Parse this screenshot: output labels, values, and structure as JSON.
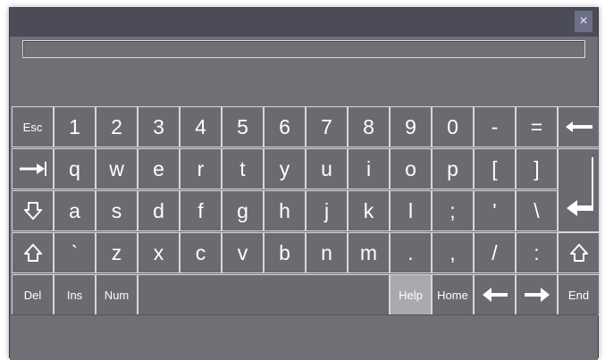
{
  "window": {
    "close_icon": "×",
    "input_value": ""
  },
  "keyboard": {
    "rows": [
      [
        {
          "label": "Esc",
          "name": "key-esc",
          "small": true
        },
        {
          "label": "1",
          "name": "key-1"
        },
        {
          "label": "2",
          "name": "key-2"
        },
        {
          "label": "3",
          "name": "key-3"
        },
        {
          "label": "4",
          "name": "key-4"
        },
        {
          "label": "5",
          "name": "key-5"
        },
        {
          "label": "6",
          "name": "key-6"
        },
        {
          "label": "7",
          "name": "key-7"
        },
        {
          "label": "8",
          "name": "key-8"
        },
        {
          "label": "9",
          "name": "key-9"
        },
        {
          "label": "0",
          "name": "key-0"
        },
        {
          "label": "-",
          "name": "key-minus"
        },
        {
          "label": "=",
          "name": "key-equals"
        },
        {
          "icon": "backspace-icon",
          "name": "key-backspace"
        }
      ],
      [
        {
          "icon": "tab-icon",
          "name": "key-tab"
        },
        {
          "label": "q",
          "name": "key-q"
        },
        {
          "label": "w",
          "name": "key-w"
        },
        {
          "label": "e",
          "name": "key-e"
        },
        {
          "label": "r",
          "name": "key-r"
        },
        {
          "label": "t",
          "name": "key-t"
        },
        {
          "label": "y",
          "name": "key-y"
        },
        {
          "label": "u",
          "name": "key-u"
        },
        {
          "label": "i",
          "name": "key-i"
        },
        {
          "label": "o",
          "name": "key-o"
        },
        {
          "label": "p",
          "name": "key-p"
        },
        {
          "label": "[",
          "name": "key-left-bracket"
        },
        {
          "label": "]",
          "name": "key-right-bracket"
        }
      ],
      [
        {
          "icon": "caps-lock-icon",
          "name": "key-caps-lock"
        },
        {
          "label": "a",
          "name": "key-a"
        },
        {
          "label": "s",
          "name": "key-s"
        },
        {
          "label": "d",
          "name": "key-d"
        },
        {
          "label": "f",
          "name": "key-f"
        },
        {
          "label": "g",
          "name": "key-g"
        },
        {
          "label": "h",
          "name": "key-h"
        },
        {
          "label": "j",
          "name": "key-j"
        },
        {
          "label": "k",
          "name": "key-k"
        },
        {
          "label": "l",
          "name": "key-l"
        },
        {
          "label": ";",
          "name": "key-semicolon"
        },
        {
          "label": "'",
          "name": "key-apostrophe"
        },
        {
          "label": "\\",
          "name": "key-backslash"
        },
        {
          "icon": "enter-icon",
          "name": "key-enter"
        }
      ],
      [
        {
          "icon": "shift-icon",
          "name": "key-shift-left"
        },
        {
          "label": "`",
          "name": "key-backtick"
        },
        {
          "label": "z",
          "name": "key-z"
        },
        {
          "label": "x",
          "name": "key-x"
        },
        {
          "label": "c",
          "name": "key-c"
        },
        {
          "label": "v",
          "name": "key-v"
        },
        {
          "label": "b",
          "name": "key-b"
        },
        {
          "label": "n",
          "name": "key-n"
        },
        {
          "label": "m",
          "name": "key-m"
        },
        {
          "label": ".",
          "name": "key-period"
        },
        {
          "label": ",",
          "name": "key-comma"
        },
        {
          "label": "/",
          "name": "key-slash"
        },
        {
          "label": ":",
          "name": "key-colon"
        },
        {
          "icon": "shift-icon",
          "name": "key-shift-right"
        }
      ],
      [
        {
          "label": "Del",
          "name": "key-del",
          "small": true
        },
        {
          "label": "Ins",
          "name": "key-ins",
          "small": true
        },
        {
          "label": "Num",
          "name": "key-num",
          "small": true
        },
        {
          "label": "",
          "name": "key-space"
        },
        {
          "label": "Help",
          "name": "key-help",
          "small": true,
          "active": true
        },
        {
          "label": "Home",
          "name": "key-home",
          "small": true
        },
        {
          "icon": "arrow-left-icon",
          "name": "key-arrow-left"
        },
        {
          "icon": "arrow-right-icon",
          "name": "key-arrow-right"
        },
        {
          "label": "End",
          "name": "key-end",
          "small": true
        }
      ]
    ]
  }
}
